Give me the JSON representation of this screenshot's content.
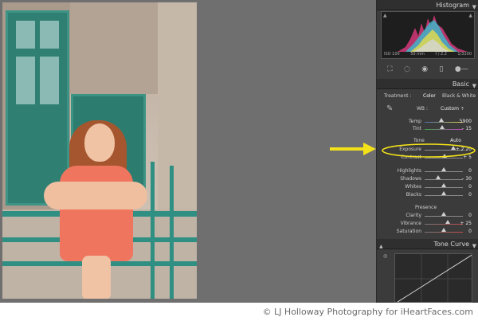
{
  "panels": {
    "histogram": {
      "title": "Histogram",
      "iso": "ISO 100",
      "focal": "50 mm",
      "aperture": "f / 2.2",
      "shutter": "1/3200"
    },
    "basic": {
      "title": "Basic",
      "treatment_label": "Treatment :",
      "treatment_color": "Color",
      "treatment_bw": "Black & White",
      "wb_label": "WB :",
      "wb_value": "Custom ÷",
      "temp": {
        "label": "Temp",
        "value": "5900"
      },
      "tint": {
        "label": "Tint",
        "value": "– 15"
      },
      "tone_label": "Tone",
      "auto_label": "Auto",
      "exposure": {
        "label": "Exposure",
        "value": "+ 2.20"
      },
      "contrast": {
        "label": "Contrast",
        "value": "+ 5"
      },
      "highlights": {
        "label": "Highlights",
        "value": "0"
      },
      "shadows": {
        "label": "Shadows",
        "value": "– 30"
      },
      "whites": {
        "label": "Whites",
        "value": "0"
      },
      "blacks": {
        "label": "Blacks",
        "value": "0"
      },
      "presence_label": "Presence",
      "clarity": {
        "label": "Clarity",
        "value": "0"
      },
      "vibrance": {
        "label": "Vibrance",
        "value": "+ 25"
      },
      "saturation": {
        "label": "Saturation",
        "value": "0"
      }
    },
    "tone_curve": {
      "title": "Tone Curve"
    }
  },
  "copyright": "© LJ Holloway Photography for iHeartFaces.com",
  "colors": {
    "highlight": "#f3e21a",
    "accent": "#e8e8e8"
  }
}
